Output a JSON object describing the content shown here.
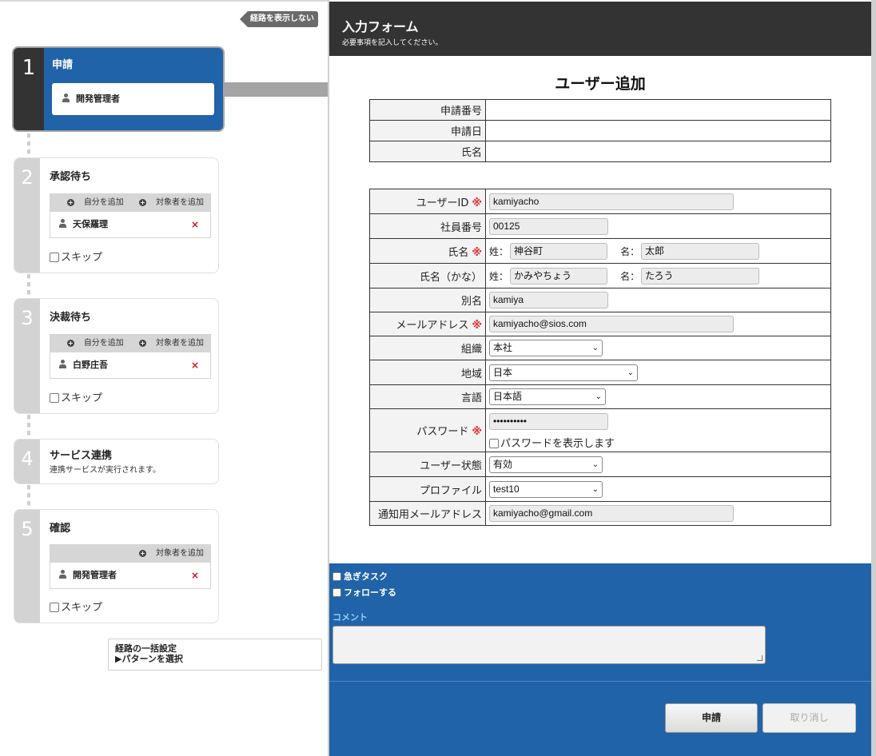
{
  "route": {
    "hide_route_label": "経路を表示しない",
    "steps": [
      {
        "num": "1",
        "title": "申請",
        "person": "開発管理者"
      },
      {
        "num": "2",
        "title": "承認待ち",
        "add_self": "自分を追加",
        "add_target": "対象者を追加",
        "person": "天保羅理",
        "remove": "×",
        "skip": "スキップ"
      },
      {
        "num": "3",
        "title": "決裁待ち",
        "add_self": "自分を追加",
        "add_target": "対象者を追加",
        "person": "白野庄吾",
        "remove": "×",
        "skip": "スキップ"
      },
      {
        "num": "4",
        "title": "サービス連携",
        "subtitle": "連携サービスが実行されます。"
      },
      {
        "num": "5",
        "title": "確認",
        "add_target": "対象者を追加",
        "person": "開発管理者",
        "remove": "×",
        "skip": "スキップ"
      }
    ],
    "bulk_title": "経路の一括設定",
    "bulk_link": "▶パターンを選択"
  },
  "form": {
    "title": "入力フォーム",
    "subtitle": "必要事項を記入してください。",
    "heading": "ユーザー追加",
    "meta": [
      {
        "label": "申請番号",
        "value": ""
      },
      {
        "label": "申請日",
        "value": ""
      },
      {
        "label": "氏名",
        "value": ""
      }
    ],
    "required_mark": "※",
    "fields": {
      "user_id_label": "ユーザーID",
      "user_id": "kamiyacho",
      "emp_no_label": "社員番号",
      "emp_no": "00125",
      "name_label": "氏名",
      "sei_prefix": "姓：",
      "mei_prefix": "名：",
      "sei": "神谷町",
      "mei": "太郎",
      "kana_label": "氏名（かな）",
      "sei_kana": "かみやちょう",
      "mei_kana": "たろう",
      "alias_label": "別名",
      "alias": "kamiya",
      "email_label": "メールアドレス",
      "email": "kamiyacho@sios.com",
      "org_label": "組織",
      "org": "本社",
      "region_label": "地域",
      "region": "日本",
      "lang_label": "言語",
      "lang": "日本語",
      "password_label": "パスワード",
      "password": "••••••••••",
      "show_password": "パスワードを表示します",
      "status_label": "ユーザー状態",
      "status": "有効",
      "profile_label": "プロファイル",
      "profile": "test10",
      "notify_email_label": "通知用メールアドレス",
      "notify_email": "kamiyacho@gmail.com"
    }
  },
  "bottom": {
    "urgent": "急ぎタスク",
    "follow": "フォローする",
    "comment_label": "コメント",
    "comment": "",
    "apply": "申請",
    "cancel": "取り消し"
  },
  "colors": {
    "accent_blue": "#2063a8",
    "header_dark": "#333333",
    "required_red": "#e03030",
    "comment_label": "#8fd3f7"
  }
}
